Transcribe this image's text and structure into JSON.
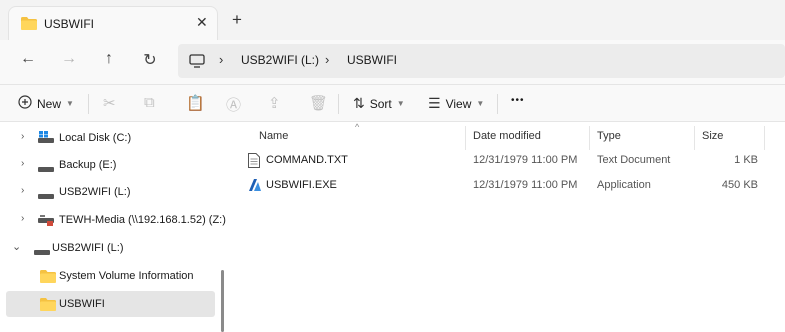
{
  "tab": {
    "title": "USBWIFI",
    "close": "✕",
    "new_tab": "+"
  },
  "nav": {
    "back": "←",
    "forward": "→",
    "up": "↑",
    "refresh": "↻"
  },
  "breadcrumb": {
    "sep": "›",
    "items": [
      "USB2WIFI (L:)",
      "USBWIFI"
    ]
  },
  "toolbar": {
    "new_label": "New",
    "sort_label": "Sort",
    "view_label": "View",
    "more": "•••"
  },
  "sidebar": {
    "items": [
      {
        "label": "Local Disk (C:)",
        "icon": "local-disk-icon"
      },
      {
        "label": "Backup (E:)",
        "icon": "drive-icon"
      },
      {
        "label": "USB2WIFI (L:)",
        "icon": "drive-icon"
      },
      {
        "label": "TEWH-Media (\\\\192.168.1.52) (Z:)",
        "icon": "network-drive-icon"
      },
      {
        "label": "USB2WIFI (L:)",
        "icon": "drive-icon",
        "expanded": true
      },
      {
        "label": "System Volume Information",
        "icon": "folder-icon"
      },
      {
        "label": "USBWIFI",
        "icon": "folder-icon",
        "selected": true
      }
    ]
  },
  "columns": [
    "Name",
    "Date modified",
    "Type",
    "Size"
  ],
  "files": [
    {
      "name": "COMMAND.TXT",
      "date": "12/31/1979 11:00 PM",
      "type": "Text Document",
      "size": "1 KB",
      "icon": "text-file-icon"
    },
    {
      "name": "USBWIFI.EXE",
      "date": "12/31/1979 11:00 PM",
      "type": "Application",
      "size": "450 KB",
      "icon": "application-icon"
    }
  ],
  "colors": {
    "folder": "#f5c242",
    "accent": "#0067c0",
    "selected_bg": "#e5e5e5"
  }
}
